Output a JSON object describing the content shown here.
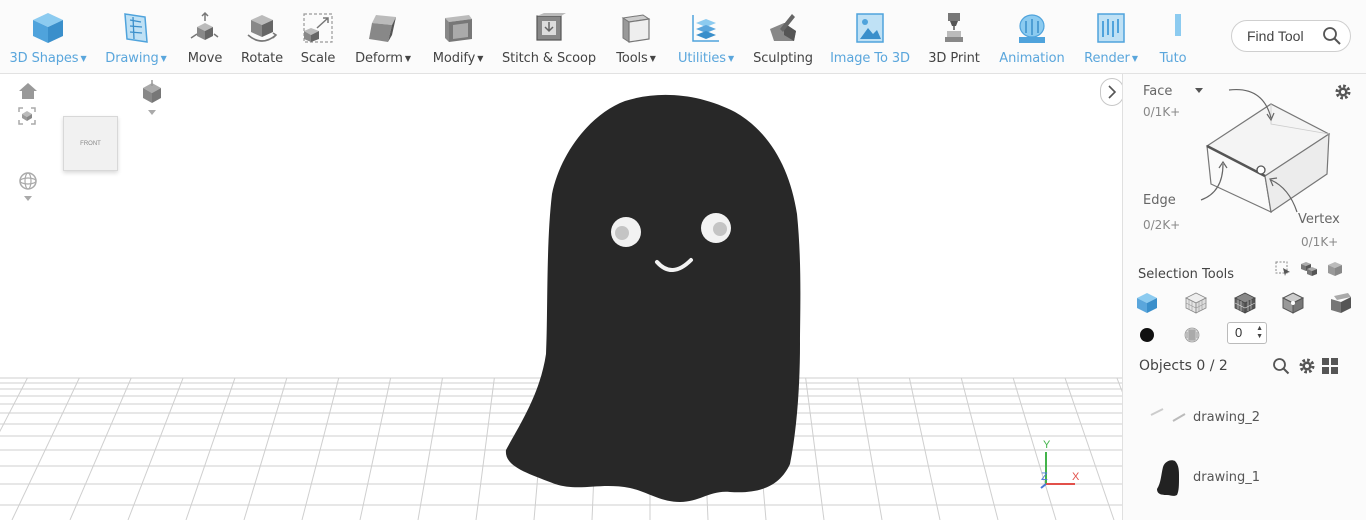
{
  "toolbar": {
    "tools": [
      {
        "id": "3d-shapes",
        "label": "3D Shapes",
        "dropdown": true,
        "blue": true,
        "icon": "cube-icon"
      },
      {
        "id": "drawing",
        "label": "Drawing",
        "dropdown": true,
        "blue": true,
        "icon": "drawing-icon"
      },
      {
        "id": "move",
        "label": "Move",
        "dropdown": false,
        "blue": false,
        "icon": "move-icon"
      },
      {
        "id": "rotate",
        "label": "Rotate",
        "dropdown": false,
        "blue": false,
        "icon": "rotate-icon"
      },
      {
        "id": "scale",
        "label": "Scale",
        "dropdown": false,
        "blue": false,
        "icon": "scale-icon"
      },
      {
        "id": "deform",
        "label": "Deform",
        "dropdown": true,
        "blue": false,
        "icon": "deform-icon"
      },
      {
        "id": "modify",
        "label": "Modify",
        "dropdown": true,
        "blue": false,
        "icon": "modify-icon"
      },
      {
        "id": "stitch-scoop",
        "label": "Stitch & Scoop",
        "dropdown": false,
        "blue": false,
        "icon": "stitch-scoop-icon"
      },
      {
        "id": "tools",
        "label": "Tools",
        "dropdown": true,
        "blue": false,
        "icon": "tools-icon"
      },
      {
        "id": "utilities",
        "label": "Utilities",
        "dropdown": true,
        "blue": true,
        "icon": "utilities-icon"
      },
      {
        "id": "sculpting",
        "label": "Sculpting",
        "dropdown": false,
        "blue": false,
        "icon": "sculpting-icon"
      },
      {
        "id": "image-to-3d",
        "label": "Image To 3D",
        "dropdown": false,
        "blue": true,
        "icon": "image-icon"
      },
      {
        "id": "3d-print",
        "label": "3D Print",
        "dropdown": false,
        "blue": false,
        "icon": "printer-icon"
      },
      {
        "id": "animation",
        "label": "Animation",
        "dropdown": false,
        "blue": true,
        "icon": "animation-icon"
      },
      {
        "id": "render",
        "label": "Render",
        "dropdown": true,
        "blue": true,
        "icon": "render-icon"
      },
      {
        "id": "tutorials",
        "label": "Tuto",
        "dropdown": false,
        "blue": true,
        "icon": "tutorials-icon"
      }
    ],
    "find_tool": "Find Tool"
  },
  "viewport": {
    "view_cube_label": "FRONT",
    "axis_y": "Y",
    "axis_x": "X",
    "axis_z": "Z"
  },
  "panel": {
    "face_label": "Face",
    "face_count": "0/1K+",
    "edge_label": "Edge",
    "edge_count": "0/2K+",
    "vertex_label": "Vertex",
    "vertex_count": "0/1K+",
    "selection_tools_label": "Selection Tools",
    "stepper_value": "0",
    "objects_label": "Objects 0 / 2",
    "objects": [
      {
        "name": "drawing_2"
      },
      {
        "name": "drawing_1"
      }
    ]
  },
  "colors": {
    "accent_blue": "#5aa6dc",
    "ghost_body": "#282828",
    "grid": "#cfcfcf"
  }
}
